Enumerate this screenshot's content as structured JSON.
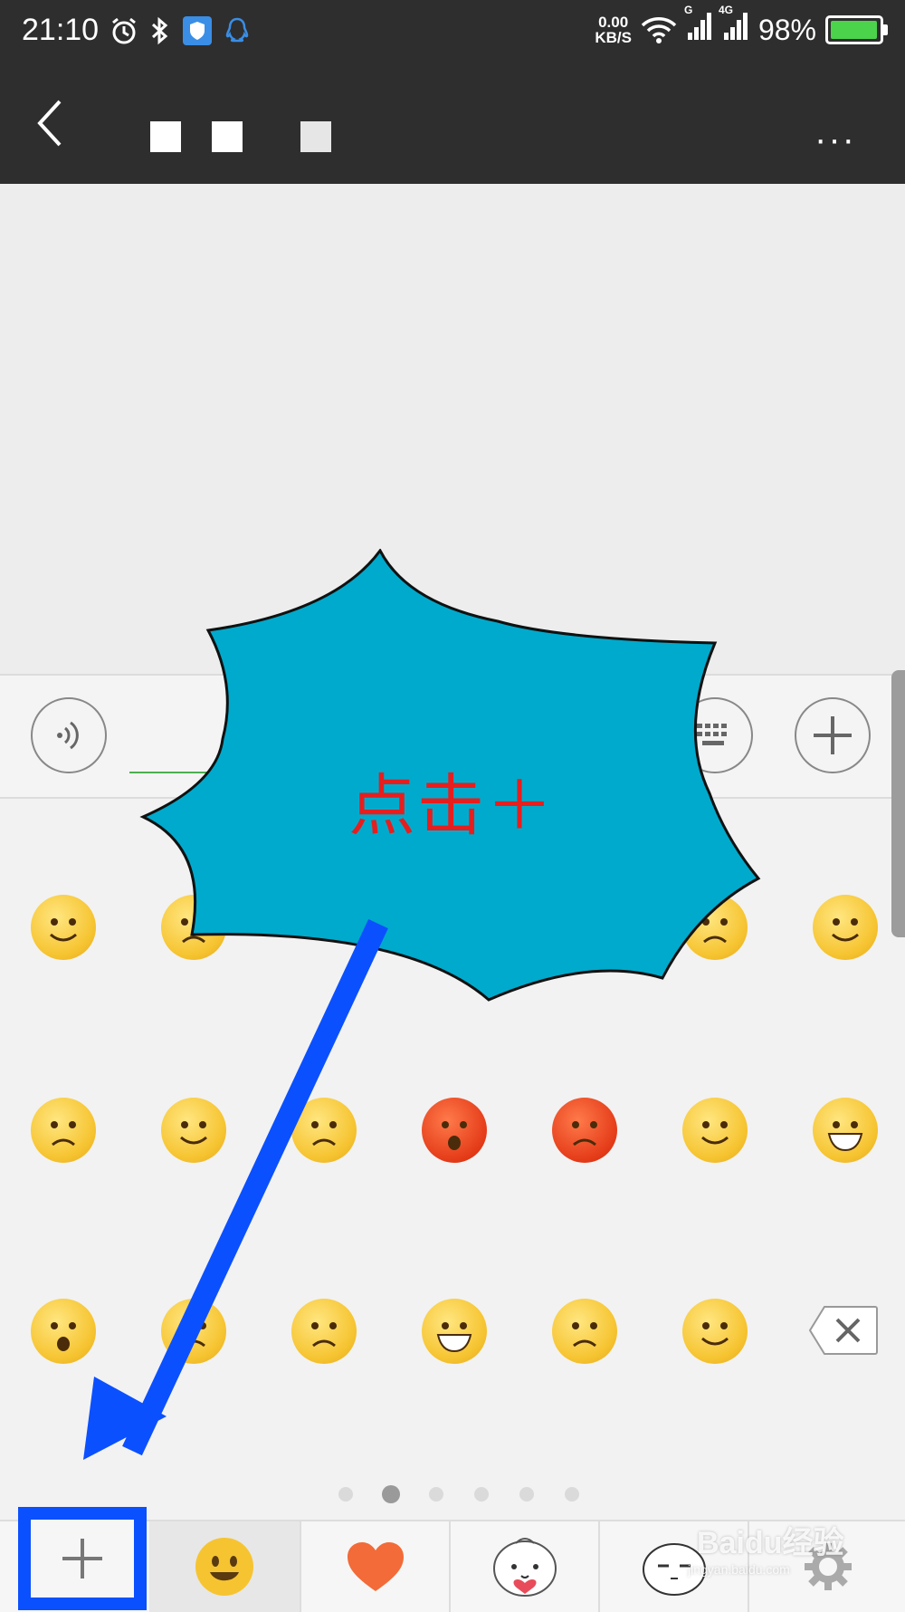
{
  "status_bar": {
    "time": "21:10",
    "net_speed_value": "0.00",
    "net_speed_unit": "KB/S",
    "signal1_label": "G",
    "signal2_label": "4G",
    "battery": "98%",
    "battery_level": 0.98
  },
  "title_bar": {
    "more_label": "···"
  },
  "annotation": {
    "callout_text": "点击＋",
    "watermark_line1": "Baidu经验",
    "watermark_line2": "jingyan.baidu.com"
  },
  "colors": {
    "header": "#2e2e2e",
    "burst": "#00aacc",
    "highlight": "#0b50ff",
    "arrow": "#0b50ff",
    "callout_text": "#e61e1e"
  },
  "page_dots": {
    "count": 6,
    "active_index": 1
  },
  "tabs": [
    {
      "name": "plus",
      "icon": "plus-icon"
    },
    {
      "name": "emoji",
      "icon": "smiley-icon"
    },
    {
      "name": "favorites",
      "icon": "heart-icon"
    },
    {
      "name": "sticker-bun",
      "icon": "bun-sticker-icon"
    },
    {
      "name": "sticker-face",
      "icon": "face-sticker-icon"
    },
    {
      "name": "settings",
      "icon": "gear-icon"
    }
  ]
}
